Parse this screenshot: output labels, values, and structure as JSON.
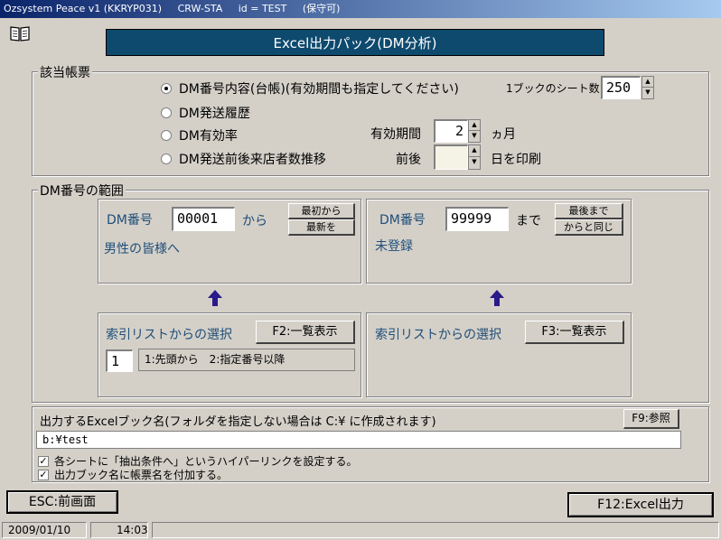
{
  "titlebar": {
    "app": "Ozsystem Peace v1 (KKRYP031)",
    "station": "CRW-STA",
    "user": "id = TEST",
    "mode": "(保守可)"
  },
  "banner": "Excel出力パック(DM分析)",
  "report_group": {
    "label": "該当帳票",
    "options": [
      {
        "label": "DM番号内容(台帳)(有効期間も指定してください)",
        "selected": true
      },
      {
        "label": "DM発送履歴",
        "selected": false
      },
      {
        "label": "DM有効率",
        "selected": false
      },
      {
        "label": "DM発送前後来店者数推移",
        "selected": false
      }
    ],
    "sheets_label": "1ブックのシート数",
    "sheets_value": "250",
    "valid_label": "有効期間",
    "valid_value": "2",
    "valid_unit": "ヵ月",
    "around_label": "前後",
    "around_value": "",
    "around_unit": "日を印刷"
  },
  "range_group": {
    "label": "DM番号の範囲",
    "from": {
      "label": "DM番号",
      "value": "00001",
      "suffix": "から",
      "btn_first": "最初から",
      "btn_newest": "最新を",
      "name": "男性の皆様へ"
    },
    "to": {
      "label": "DM番号",
      "value": "99999",
      "suffix": "まで",
      "btn_last": "最後まで",
      "btn_same": "からと同じ",
      "name": "未登録"
    },
    "index_left": {
      "label": "索引リストからの選択",
      "button": "F2:一覧表示",
      "mode_value": "1",
      "mode_text": "1:先頭から　2:指定番号以降"
    },
    "index_right": {
      "label": "索引リストからの選択",
      "button": "F3:一覧表示"
    }
  },
  "output": {
    "label": "出力するExcelブック名(フォルダを指定しない場合は C:¥ に作成されます)",
    "browse": "F9:参照",
    "path": "b:¥test",
    "check1": "各シートに「抽出条件へ」というハイパーリンクを設定する。",
    "check2": "出力ブック名に帳票名を付加する。"
  },
  "footer": {
    "esc": "ESC:前画面",
    "f12": "F12:Excel出力"
  },
  "status": {
    "date": "2009/01/10",
    "time": "14:03"
  },
  "colors": {
    "face": "#d4d0c8",
    "banner": "#0e4a6e",
    "label_blue": "#1f4e79",
    "arrow": "#2a1a8a"
  }
}
